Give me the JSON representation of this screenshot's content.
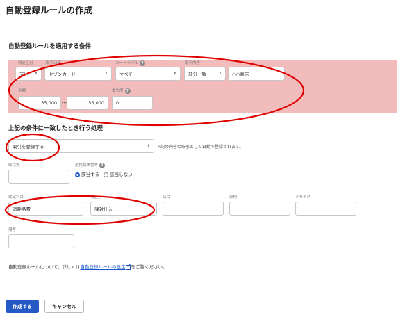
{
  "page": {
    "title": "自動登録ルールの作成"
  },
  "conditions": {
    "heading": "自動登録ルールを適用する条件",
    "direction": {
      "label": "収支区分",
      "value": "支出"
    },
    "account": {
      "label": "取引口座",
      "value": "セゾンカード"
    },
    "card_label": {
      "label": "カードラベル",
      "value": "すべて"
    },
    "content": {
      "label": "取引内容",
      "match_value": "部分一致",
      "text": "○○商店"
    },
    "amount": {
      "label": "金額",
      "min": "55,000",
      "separator": "〜",
      "max": "55,000"
    },
    "priority": {
      "label": "優先度",
      "value": "0"
    }
  },
  "processing": {
    "heading": "上記の条件に一致したとき行う処理",
    "action_value": "取引を登録する",
    "action_note": "下記の内容の取引として自動で登録されます。",
    "partner_label": "取引先",
    "invoice_label": "適格請求書等",
    "invoice_options": [
      "該当する",
      "該当しない"
    ],
    "account_item": {
      "label": "勘定科目",
      "value": "消耗品費"
    },
    "tax": {
      "label": "税区分",
      "value": "課対仕入"
    },
    "item_label": "品目",
    "department_label": "部門",
    "memo_label": "メモタグ",
    "remarks_label": "備考"
  },
  "footer": {
    "note_prefix": "自動登録ルールについて、詳しくは",
    "note_link": "自動登録ルールの設定",
    "note_suffix": "をご覧ください。",
    "create_label": "作成する",
    "cancel_label": "キャンセル"
  },
  "colors": {
    "accent": "#2459c6",
    "highlight": "#f2bcbc",
    "annotation": "#e00000"
  },
  "icons": {
    "help": "help-circle-icon",
    "caret": "chevron-down-icon",
    "external": "external-link-icon"
  }
}
